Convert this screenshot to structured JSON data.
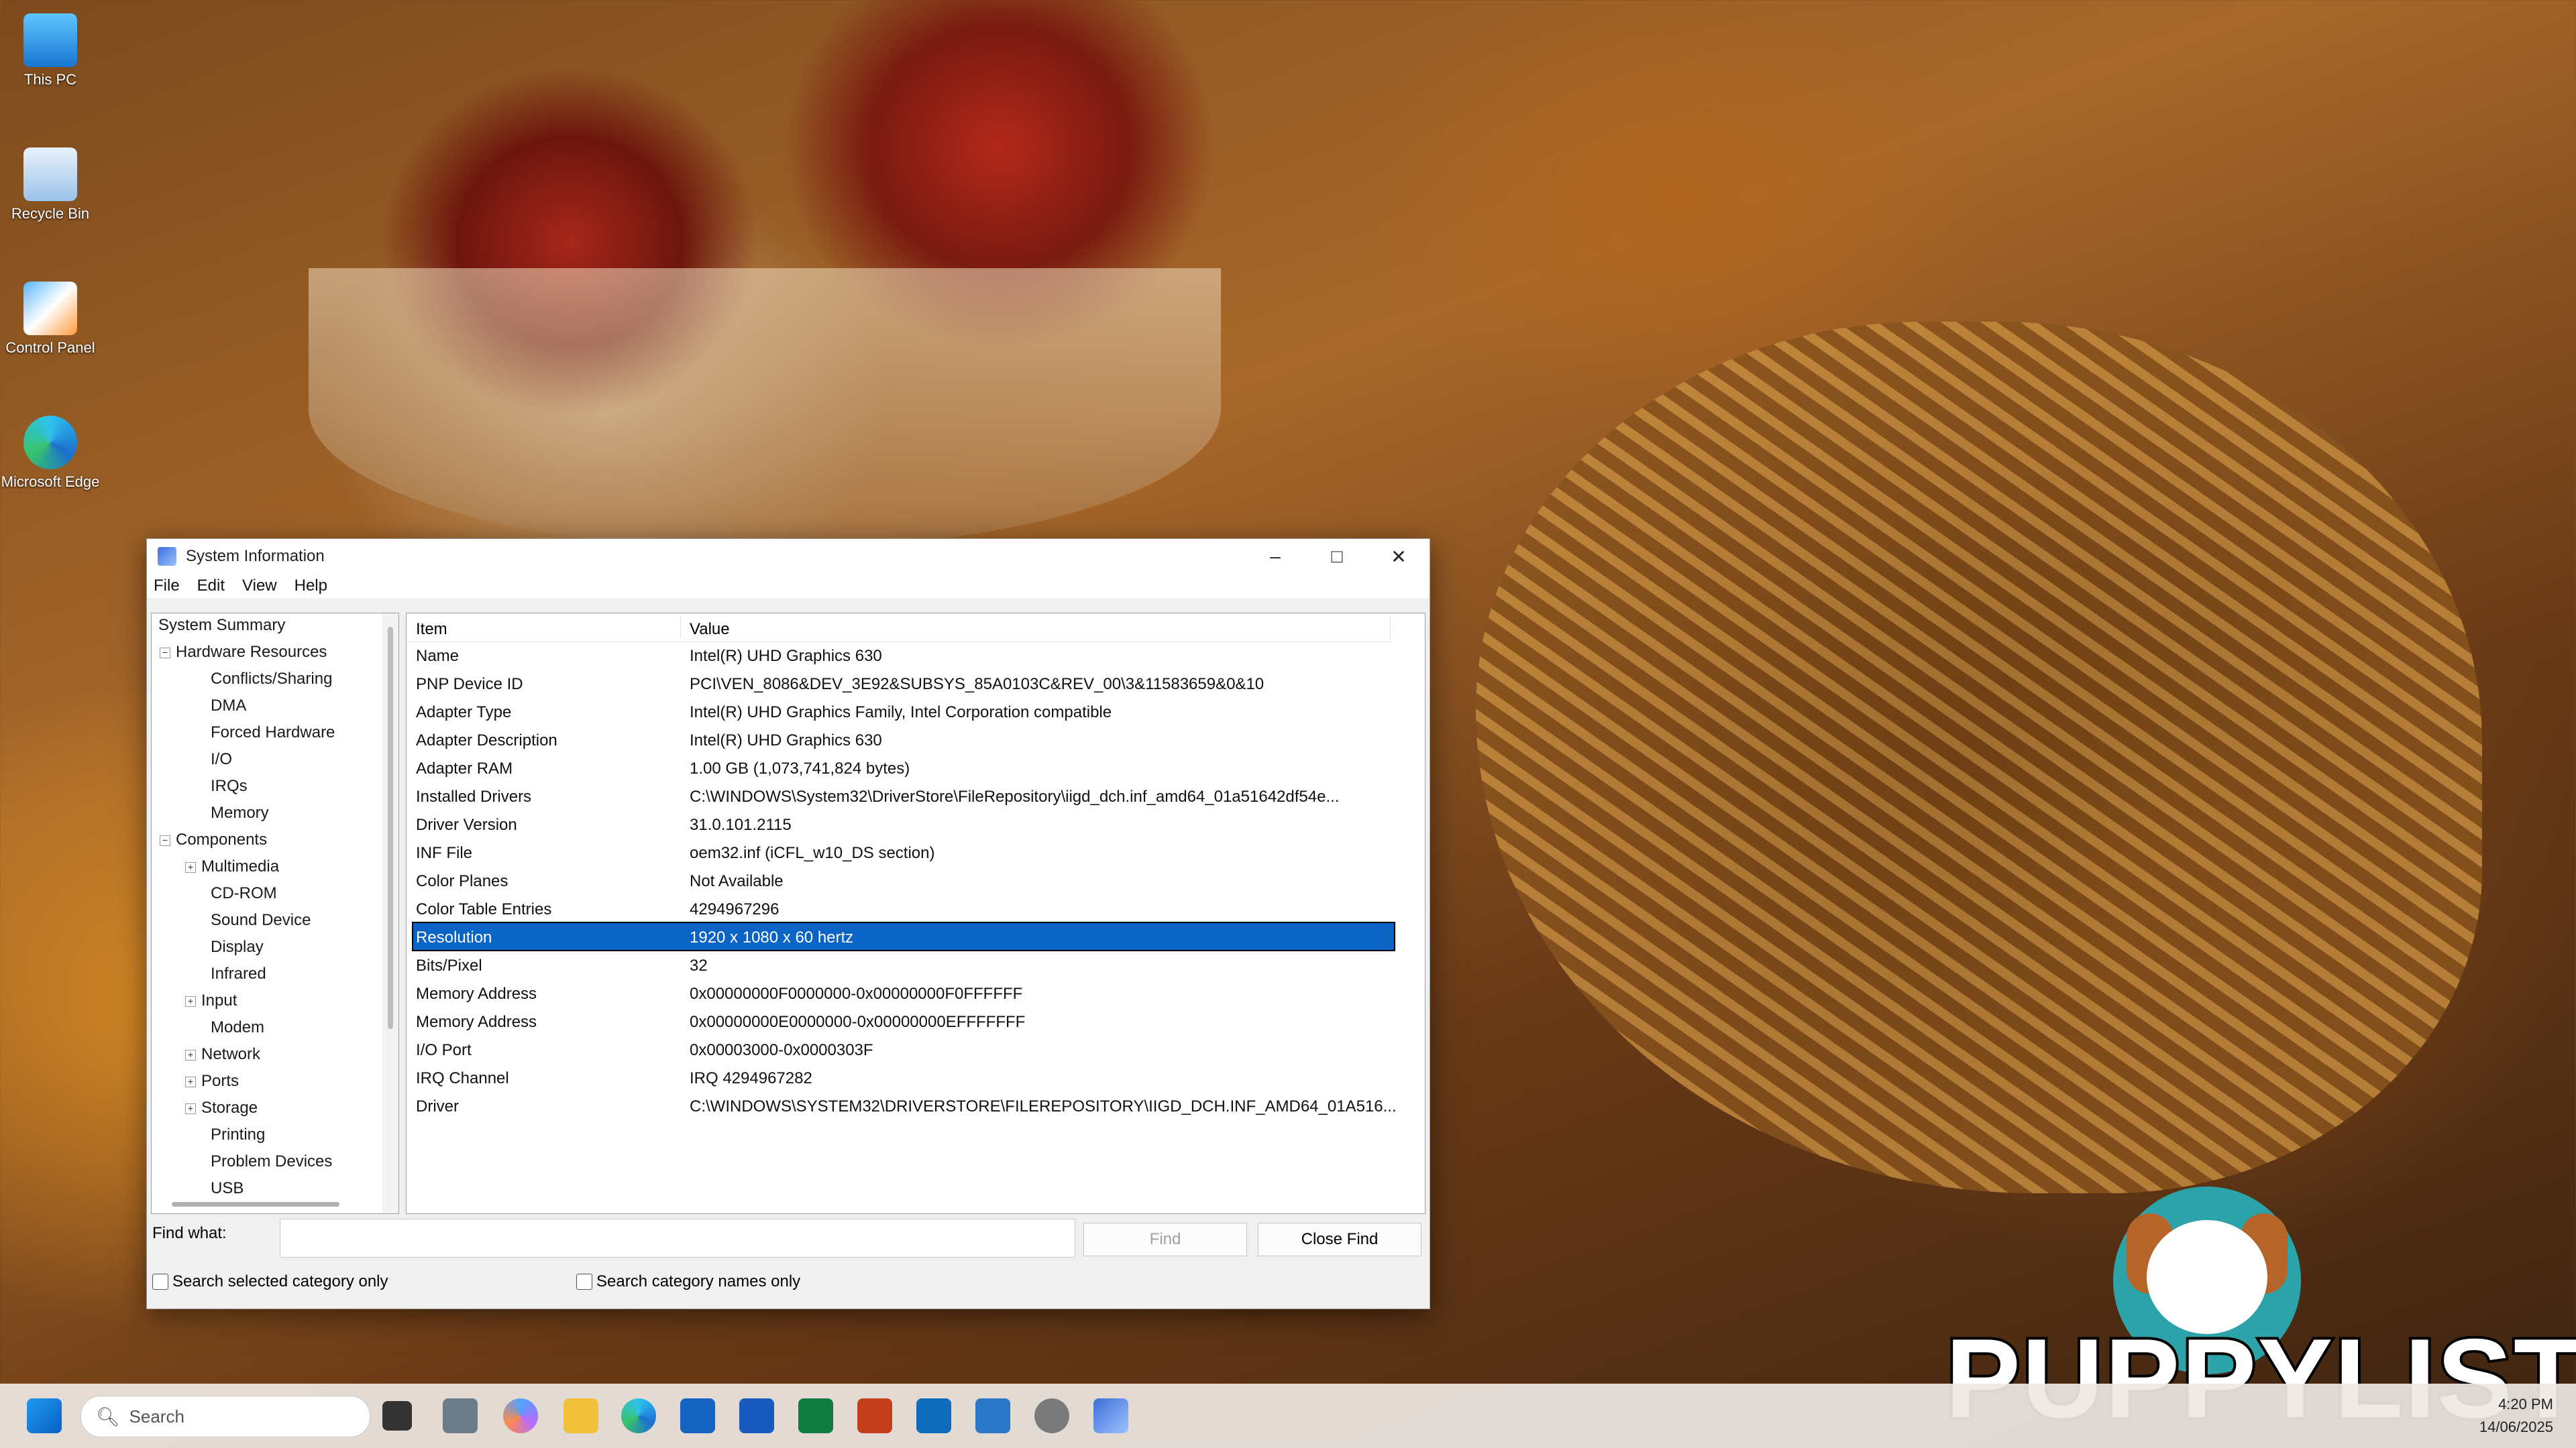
{
  "desktop": {
    "icons": [
      {
        "label": "This PC",
        "icon": "this-pc-icon"
      },
      {
        "label": "Recycle Bin",
        "icon": "recycle-bin-icon"
      },
      {
        "label": "Control Panel",
        "icon": "control-panel-icon"
      },
      {
        "label": "Microsoft Edge",
        "icon": "edge-icon"
      }
    ]
  },
  "window": {
    "title": "System Information",
    "menu": [
      "File",
      "Edit",
      "View",
      "Help"
    ]
  },
  "tree": [
    "System Summary",
    "Hardware Resources",
    "Conflicts/Sharing",
    "DMA",
    "Forced Hardware",
    "I/O",
    "IRQs",
    "Memory",
    "Components",
    "Multimedia",
    "CD-ROM",
    "Sound Device",
    "Display",
    "Infrared",
    "Input",
    "Modem",
    "Network",
    "Ports",
    "Storage",
    "Printing",
    "Problem Devices",
    "USB"
  ],
  "table": {
    "headers": [
      "Item",
      "Value"
    ],
    "rows": [
      [
        "Name",
        "Intel(R) UHD Graphics 630"
      ],
      [
        "PNP Device ID",
        "PCI\\VEN_8086&DEV_3E92&SUBSYS_85A0103C&REV_00\\3&11583659&0&10"
      ],
      [
        "Adapter Type",
        "Intel(R) UHD Graphics Family, Intel Corporation compatible"
      ],
      [
        "Adapter Description",
        "Intel(R) UHD Graphics 630"
      ],
      [
        "Adapter RAM",
        "1.00 GB (1,073,741,824 bytes)"
      ],
      [
        "Installed Drivers",
        "C:\\WINDOWS\\System32\\DriverStore\\FileRepository\\iigd_dch.inf_amd64_01a51642df54e..."
      ],
      [
        "Driver Version",
        "31.0.101.2115"
      ],
      [
        "INF File",
        "oem32.inf (iCFL_w10_DS section)"
      ],
      [
        "Color Planes",
        "Not Available"
      ],
      [
        "Color Table Entries",
        "4294967296"
      ],
      [
        "Resolution",
        "1920 x 1080 x 60 hertz"
      ],
      [
        "Bits/Pixel",
        "32"
      ],
      [
        "Memory Address",
        "0x00000000F0000000-0x00000000F0FFFFFF"
      ],
      [
        "Memory Address",
        "0x00000000E0000000-0x00000000EFFFFFFF"
      ],
      [
        "I/O Port",
        "0x00003000-0x0000303F"
      ],
      [
        "IRQ Channel",
        "IRQ 4294967282"
      ],
      [
        "Driver",
        "C:\\WINDOWS\\SYSTEM32\\DRIVERSTORE\\FILEREPOSITORY\\IIGD_DCH.INF_AMD64_01A516..."
      ]
    ]
  },
  "find": {
    "label": "Find what:",
    "value": "",
    "find_button": "Find",
    "close_button": "Close Find",
    "check1": "Search selected category only",
    "check2": "Search category names only"
  },
  "taskbar": {
    "search_placeholder": "Search",
    "time": "4:20 PM",
    "date": "14/06/2025"
  },
  "watermark": "PUPPYLIST"
}
